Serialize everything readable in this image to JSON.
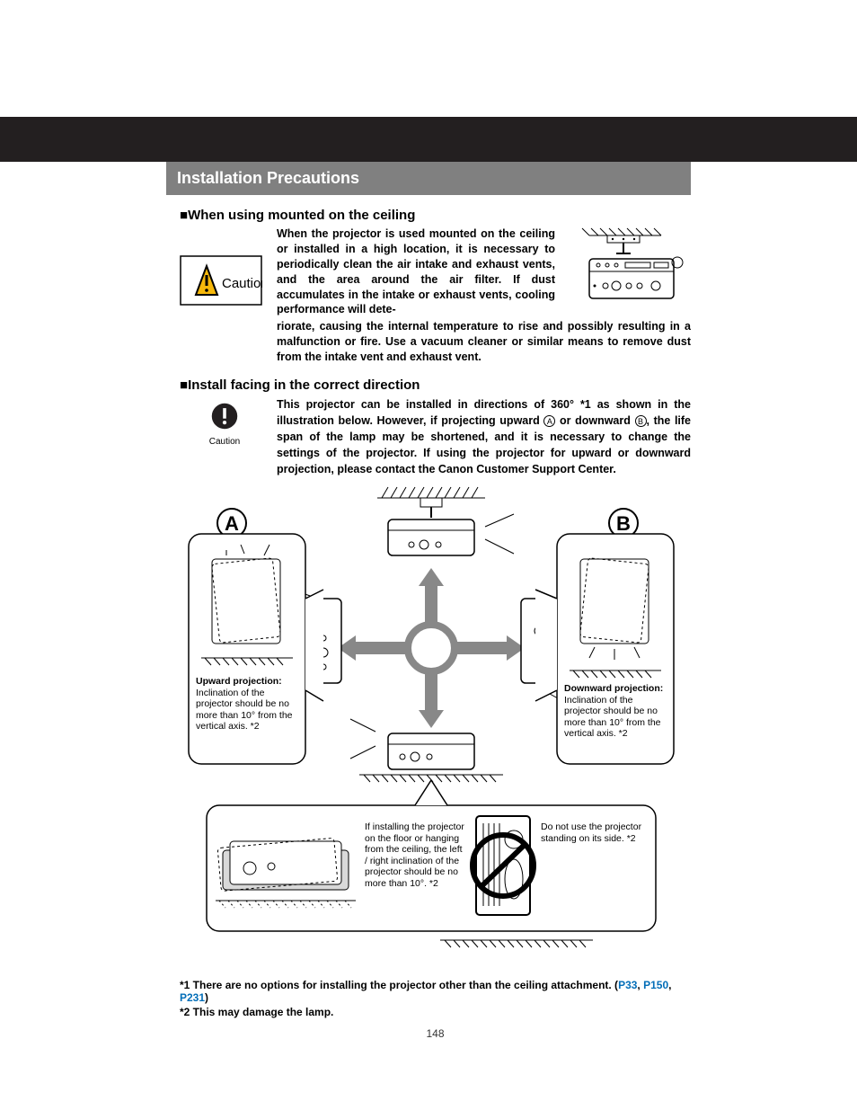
{
  "title_bar": "Installation Precautions",
  "section1": {
    "heading": "When using mounted on the ceiling",
    "para_col": "When the projector is used mounted on the ceiling or installed in a high location, it is necessary to periodically clean the air intake and exhaust vents, and the area around the air filter. If dust accumulates in the intake or exhaust vents, cooling performance will dete-",
    "para_full": "riorate, causing the internal temperature to rise and possibly resulting in a malfunction or fire. Use a vacuum cleaner or similar means to remove dust from the intake vent and exhaust vent."
  },
  "caution_box_label": "Caution",
  "caution_round_label": "Caution",
  "section2": {
    "heading": "Install facing in the correct direction",
    "para_before_A": "This projector can be installed in directions of 360° *1 as shown in the illustration below. However, if projecting upward ",
    "para_mid": " or downward ",
    "para_after_B": ", the life span of the lamp may be shortened, and it is necessary to change the settings of the projector. If using the projector for upward or downward projection, please contact the Canon Customer Support Center."
  },
  "labels": {
    "A": "A",
    "B": "B",
    "up_title": "Upward projection:",
    "up_body": "Inclination of the projector should be no more than 10° from the vertical axis. *2",
    "down_title": "Downward projection:",
    "down_body": "Inclination of the projector should be no more than 10° from the vertical axis. *2",
    "floor_body": "If installing the projector on the floor or hanging from the ceiling, the left / right inclination of the projector should be no more than 10°. *2",
    "side_body": "Do not use the projector standing on its side. *2"
  },
  "footnotes": {
    "f1_pre": "*1 There are no options for installing the projector other than the ceiling attachment. (",
    "p33": "P33",
    "p150": "P150",
    "p231": "P231",
    "f1_post": ")",
    "f2": "*2 This may damage the lamp."
  },
  "page_number": "148"
}
